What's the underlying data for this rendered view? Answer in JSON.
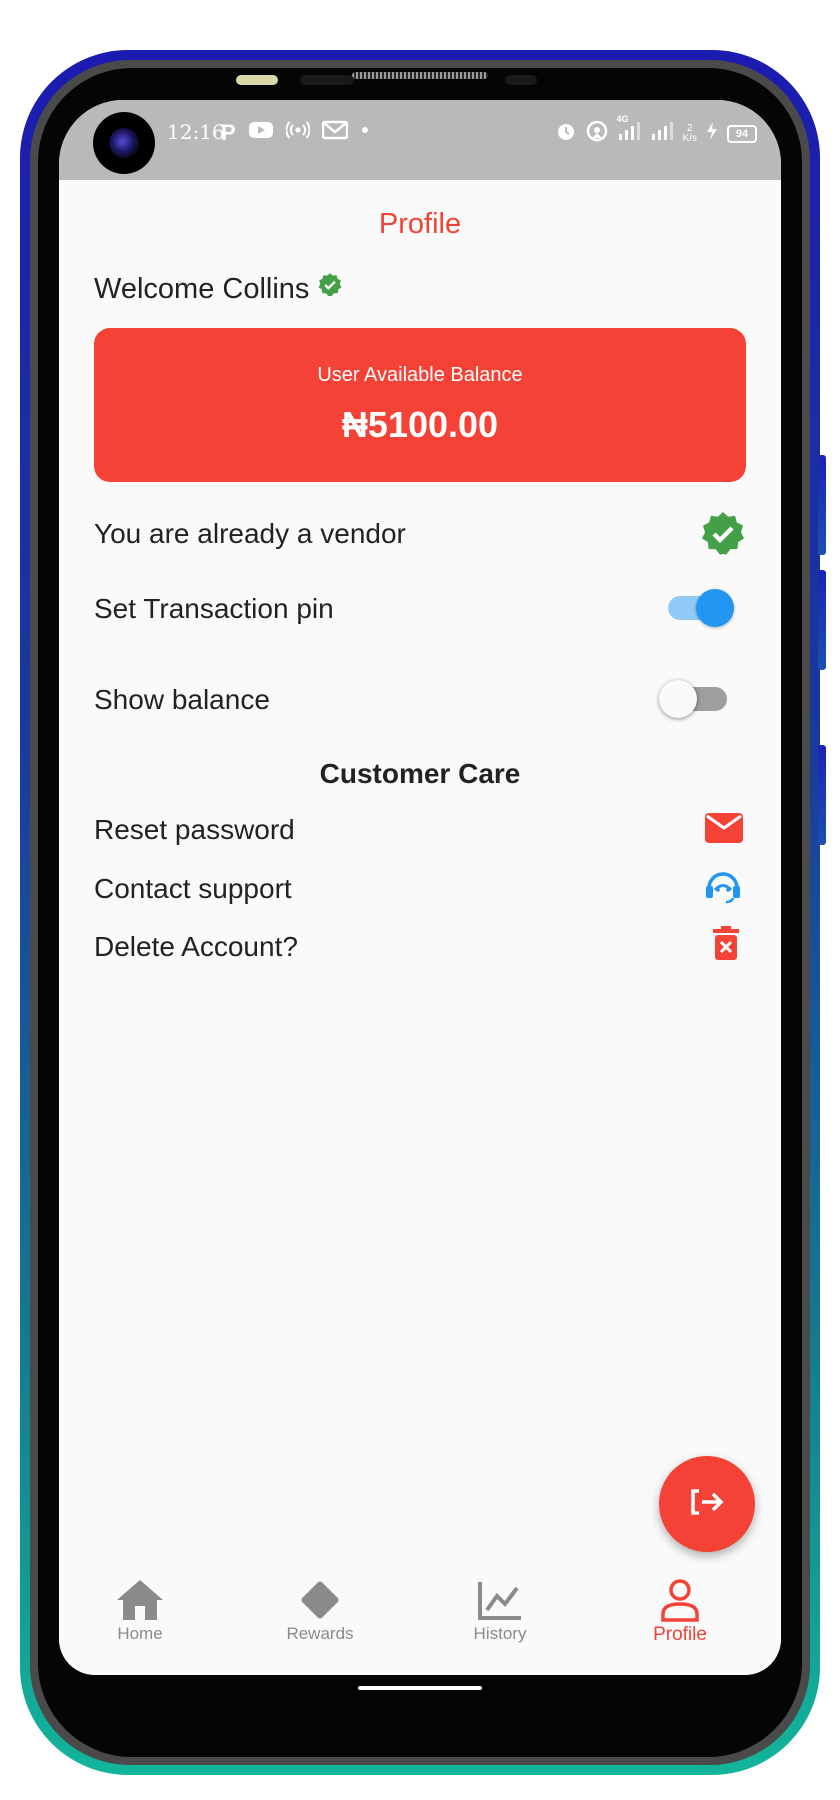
{
  "status_bar": {
    "time": "12:16",
    "battery": "94",
    "network_speed_value": "2",
    "network_speed_unit": "K/s",
    "network_type": "4G",
    "left_icons": [
      "parking-icon",
      "youtube-icon",
      "hotspot-icon",
      "gmail-icon",
      "dot-icon"
    ],
    "right_icons": [
      "alarm-icon",
      "location-icon",
      "signal-icon",
      "signal-icon",
      "charging-icon"
    ]
  },
  "header": {
    "title": "Profile"
  },
  "welcome": {
    "text": "Welcome Collins",
    "verified_icon": "verified-badge-icon"
  },
  "balance_card": {
    "label": "User Available Balance",
    "amount": "₦5100.00",
    "color": "#f44336"
  },
  "vendor_row": {
    "label": "You are already a vendor",
    "icon": "verified-badge-icon"
  },
  "transaction_pin_row": {
    "label": "Set Transaction pin",
    "toggle_on": true
  },
  "show_balance_row": {
    "label": "Show balance",
    "toggle_on": false
  },
  "customer_care": {
    "title": "Customer Care",
    "items": [
      {
        "label": "Reset password",
        "icon": "mail-icon"
      },
      {
        "label": "Contact support",
        "icon": "support-agent-icon"
      },
      {
        "label": "Delete Account?",
        "icon": "delete-icon"
      }
    ]
  },
  "logout_fab": {
    "icon": "logout-icon"
  },
  "bottom_nav": {
    "items": [
      {
        "label": "Home",
        "icon": "home-icon",
        "active": false
      },
      {
        "label": "Rewards",
        "icon": "diamond-icon",
        "active": false
      },
      {
        "label": "History",
        "icon": "chart-icon",
        "active": false
      },
      {
        "label": "Profile",
        "icon": "person-icon",
        "active": true
      }
    ]
  },
  "colors": {
    "accent": "#f44336",
    "toggle_active": "#2196f3",
    "verified": "#43a047",
    "support_icon": "#2196f3",
    "nav_inactive": "#8a8a8a"
  }
}
